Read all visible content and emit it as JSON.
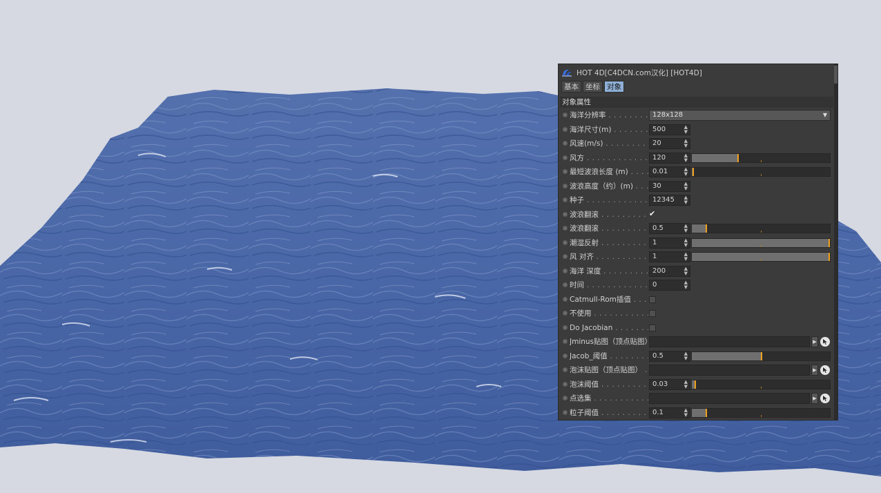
{
  "panel": {
    "title": "HOT 4D[C4DCN.com汉化] [HOT4D]",
    "tabs": [
      {
        "label": "基本",
        "active": false
      },
      {
        "label": "坐标",
        "active": false
      },
      {
        "label": "对象",
        "active": true
      }
    ],
    "section_title": "对象属性",
    "rows": [
      {
        "label": "海洋分辨率",
        "type": "dropdown",
        "value": "128x128"
      },
      {
        "label": "海洋尺寸(m)",
        "type": "number",
        "value": "500"
      },
      {
        "label": "风速(m/s)",
        "type": "number",
        "value": "20"
      },
      {
        "label": "风方",
        "type": "number_slider",
        "value": "120",
        "level": 0.33
      },
      {
        "label": "最短波浪长度 (m)",
        "type": "number_slider",
        "value": "0.01",
        "level": 0.005
      },
      {
        "label": "波浪高度（约）(m)",
        "type": "number",
        "value": "30"
      },
      {
        "label": "种子",
        "type": "number",
        "value": "12345"
      },
      {
        "label": "波浪翻滚",
        "type": "checkbox",
        "checked": true
      },
      {
        "label": "波浪翻滚",
        "type": "number_slider",
        "value": "0.5",
        "level": 0.1
      },
      {
        "label": "潮湿反射",
        "type": "number_slider",
        "value": "1",
        "level": 1.0
      },
      {
        "label": "风 对齐",
        "type": "number_slider",
        "value": "1",
        "level": 1.0
      },
      {
        "label": "海洋 深度",
        "type": "number",
        "value": "200"
      },
      {
        "label": "时间",
        "type": "number",
        "value": "0"
      },
      {
        "label": "Catmull-Rom插值",
        "type": "checkbox",
        "checked": false
      },
      {
        "label": "不使用",
        "type": "checkbox",
        "checked": false
      },
      {
        "label": "Do Jacobian",
        "type": "checkbox",
        "checked": false
      },
      {
        "label": "Jminus贴图（顶点贴图）",
        "type": "link",
        "value": ""
      },
      {
        "label": "Jacob_阈值",
        "type": "number_slider",
        "value": "0.5",
        "level": 0.5
      },
      {
        "label": "泡沫贴图（顶点贴图）",
        "type": "link",
        "value": ""
      },
      {
        "label": "泡沫阈值",
        "type": "number_slider",
        "value": "0.03",
        "level": 0.02
      },
      {
        "label": "点选集",
        "type": "link",
        "value": ""
      },
      {
        "label": "粒子阈值",
        "type": "number_slider",
        "value": "0.1",
        "level": 0.1
      }
    ]
  },
  "colors": {
    "background": "#d6d9e2",
    "ocean": "#4a6aa8",
    "panel_bg": "#3b3b3b",
    "accent": "#f0a21e",
    "tab_active": "#8fb0d6"
  },
  "icons": {
    "logo": "hot4d-logo-icon",
    "spinner": "spinner-arrows-icon",
    "link_arrow": "link-arrow-icon",
    "pick": "pick-object-icon",
    "dropdown": "chevron-down-icon"
  }
}
